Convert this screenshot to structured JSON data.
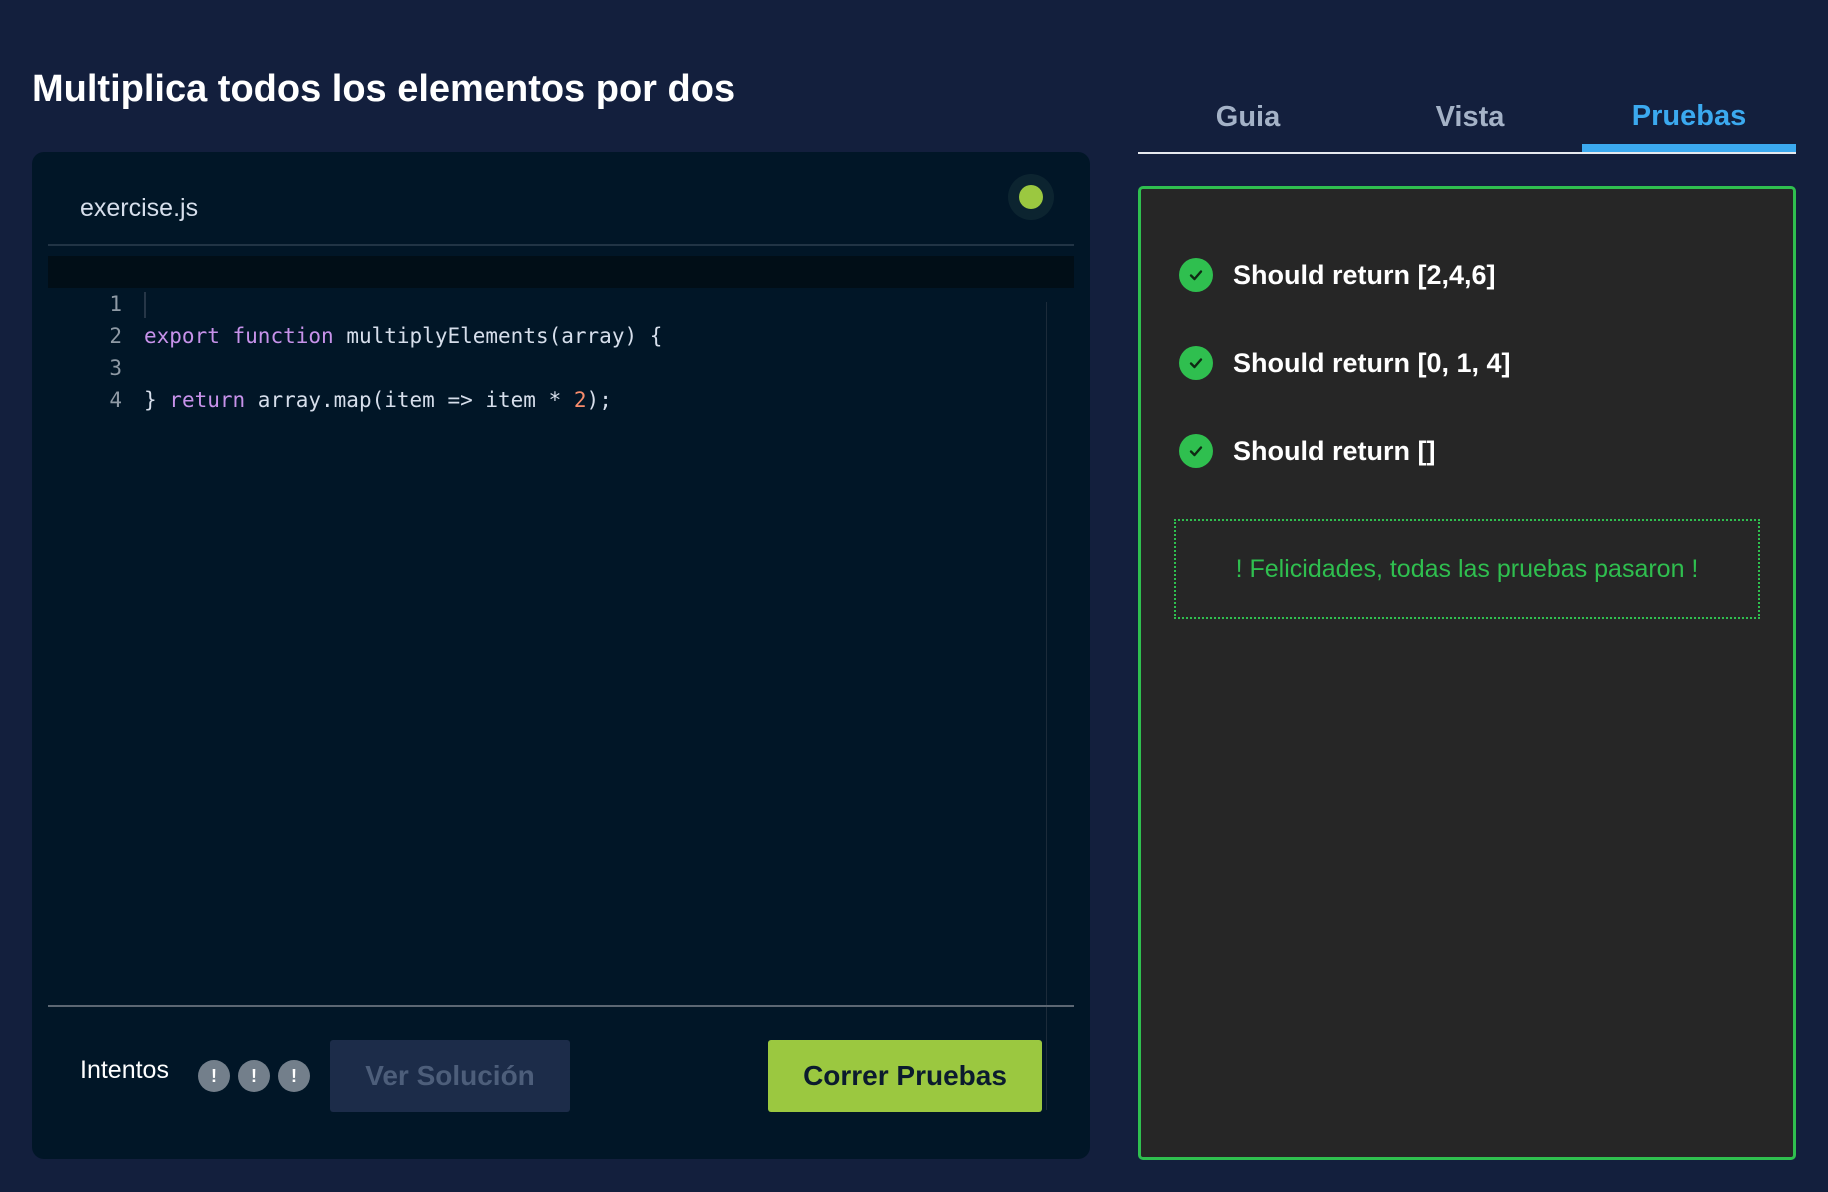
{
  "page": {
    "title": "Multiplica todos los elementos por dos"
  },
  "editor": {
    "filename": "exercise.js",
    "status_icon": "status-dot-icon",
    "lines": [
      {
        "number": "1",
        "tokens": [
          {
            "t": "export",
            "c": "kw"
          },
          {
            "t": " ",
            "c": ""
          },
          {
            "t": "function",
            "c": "kw"
          },
          {
            "t": " multiplyElements(array) {",
            "c": "fn"
          }
        ]
      },
      {
        "number": "2",
        "tokens": [
          {
            "t": "  ",
            "c": ""
          },
          {
            "t": "return",
            "c": "kw"
          },
          {
            "t": " array.map(item => item * ",
            "c": "fn"
          },
          {
            "t": "2",
            "c": "num"
          },
          {
            "t": ");",
            "c": "fn"
          }
        ]
      },
      {
        "number": "3",
        "tokens": [
          {
            "t": "}",
            "c": "fn"
          }
        ]
      },
      {
        "number": "4",
        "tokens": []
      }
    ]
  },
  "footer": {
    "attempts_label": "Intentos",
    "attempts": [
      "!",
      "!",
      "!"
    ],
    "solution_button": "Ver Solución",
    "run_button": "Correr Pruebas"
  },
  "tabs": [
    {
      "label": "Guia",
      "active": false
    },
    {
      "label": "Vista",
      "active": false
    },
    {
      "label": "Pruebas",
      "active": true
    }
  ],
  "tests": {
    "items": [
      {
        "label": "Should return [2,4,6]",
        "status": "passed"
      },
      {
        "label": "Should return [0, 1, 4]",
        "status": "passed"
      },
      {
        "label": "Should return []",
        "status": "passed"
      }
    ],
    "success_message": "! Felicidades, todas las pruebas pasaron !"
  },
  "colors": {
    "background": "#131f3d",
    "editor_bg": "#011627",
    "accent_green": "#2fbf4f",
    "button_green": "#9bc840",
    "tab_active": "#3ba9ef"
  }
}
